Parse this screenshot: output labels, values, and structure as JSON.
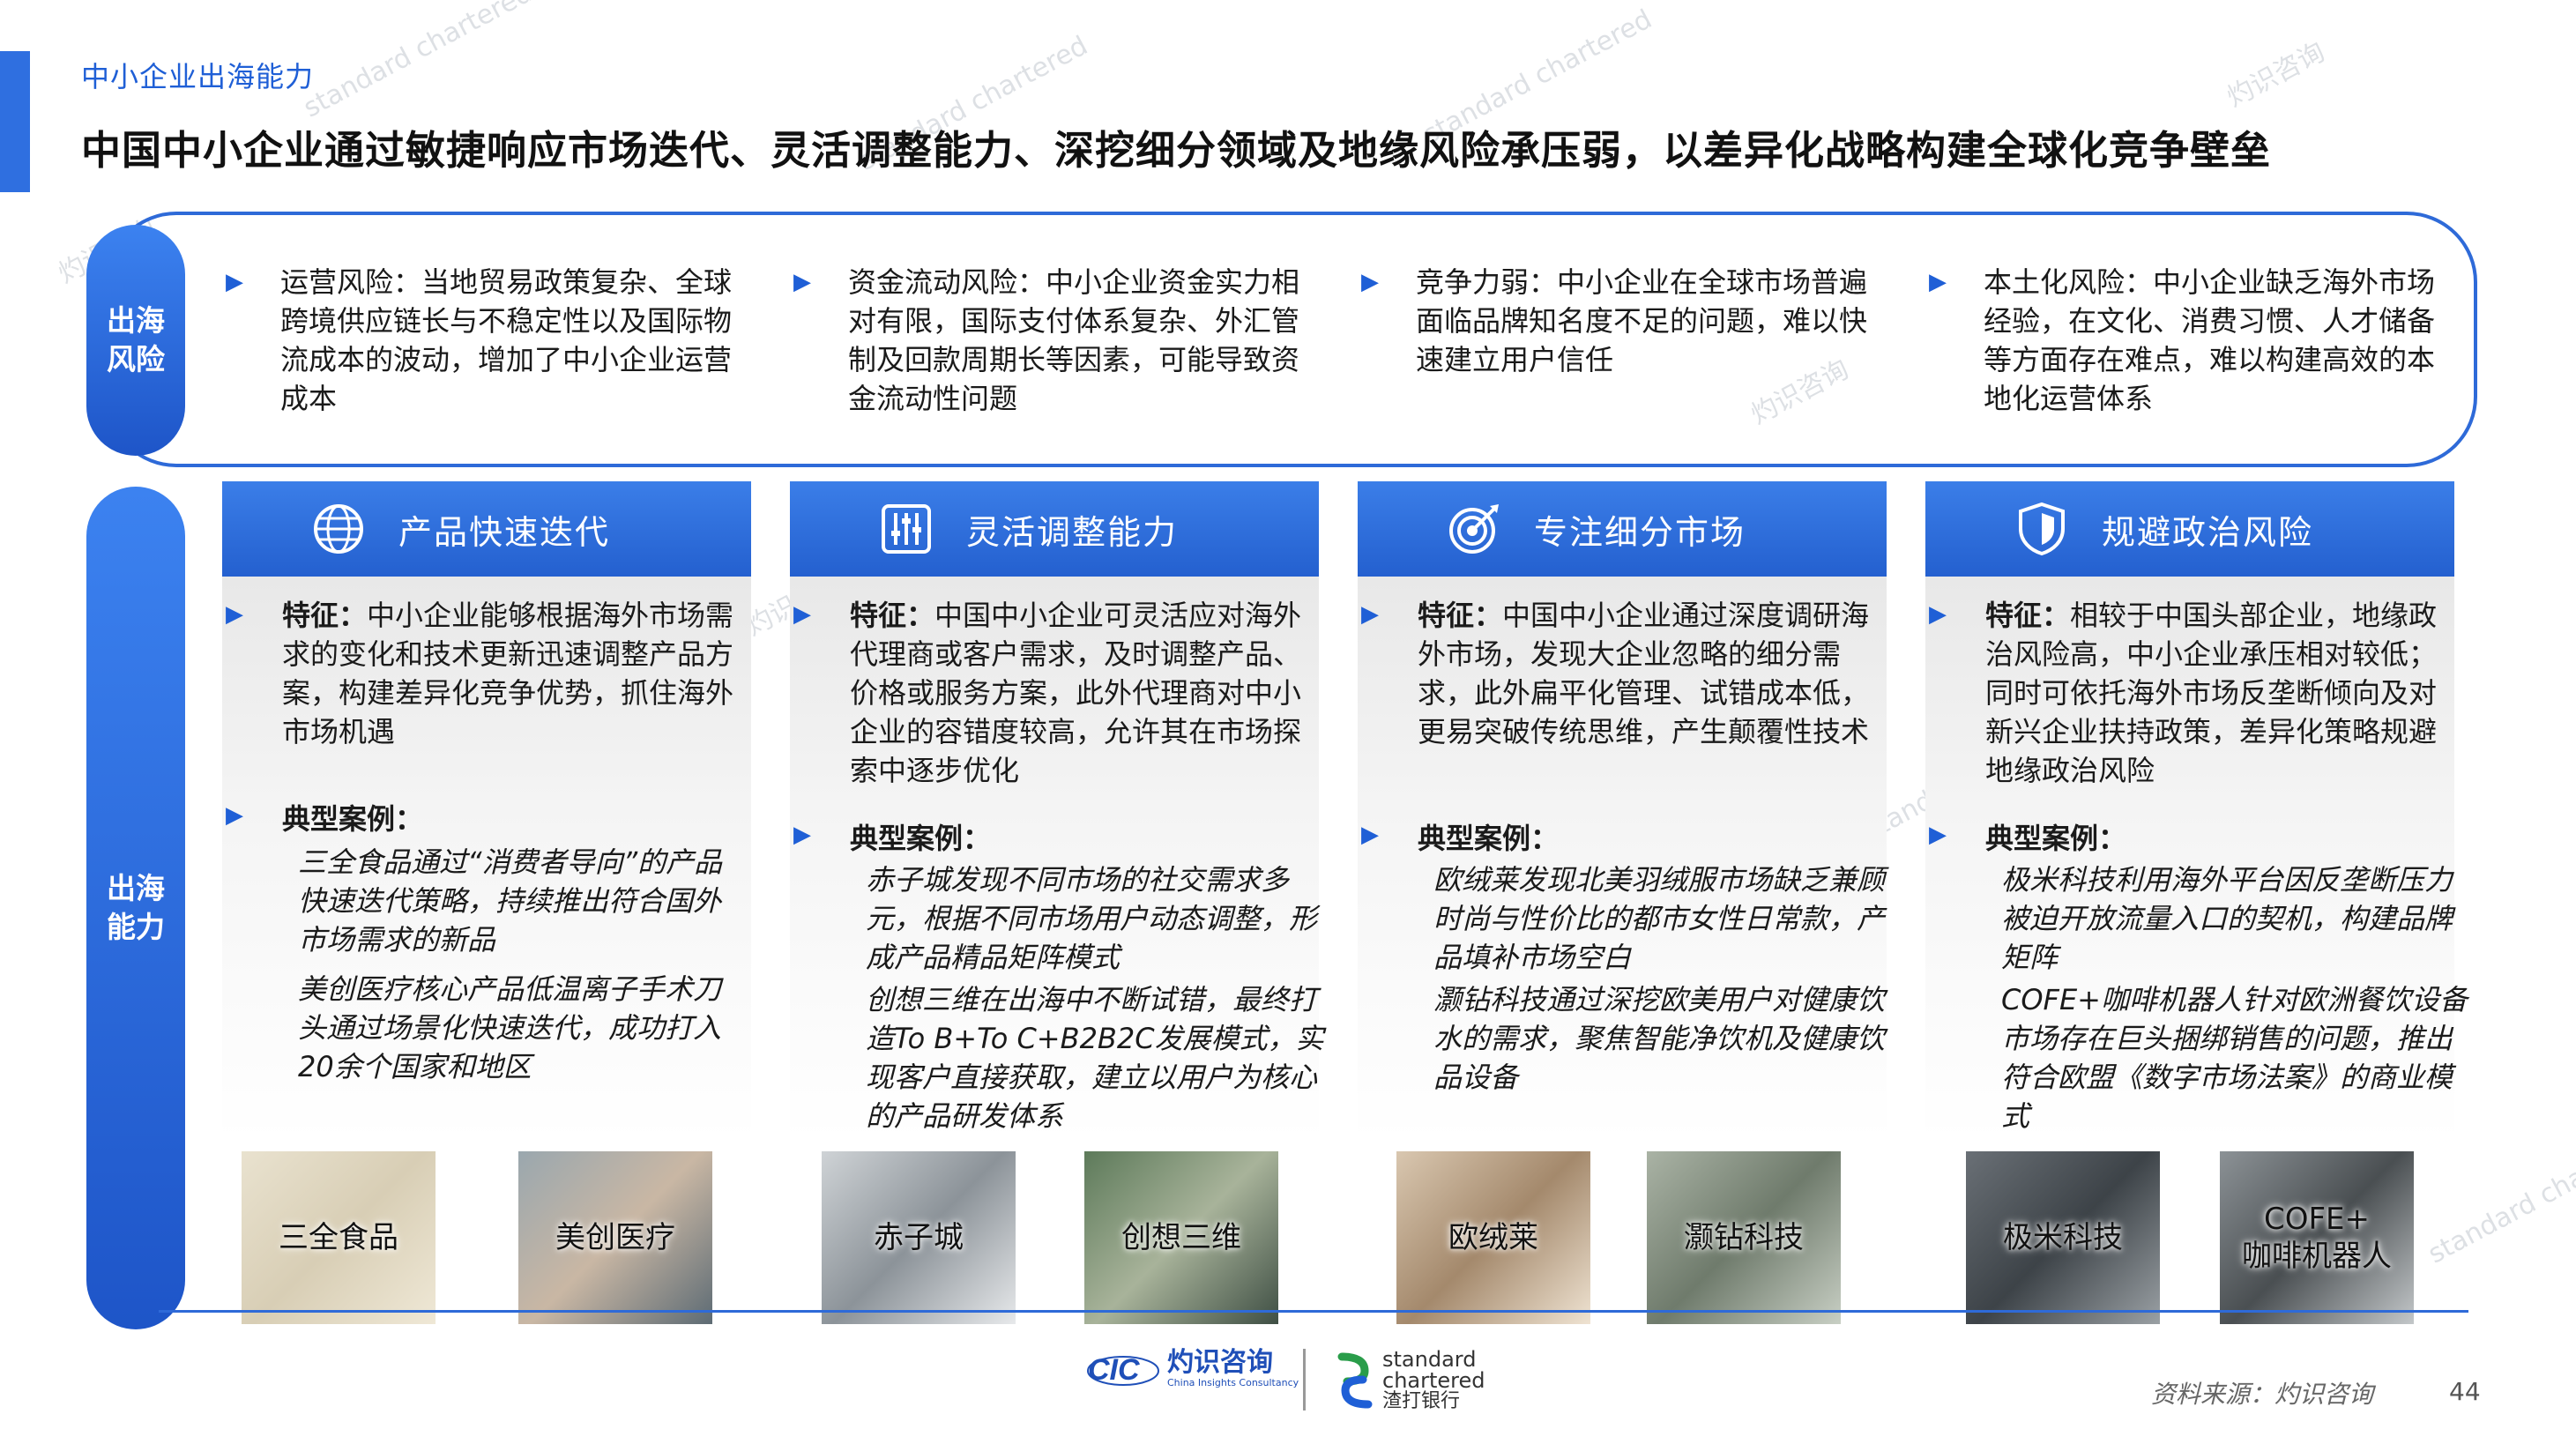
{
  "section_label": "中小企业出海能力",
  "headline": "中国中小企业通过敏捷响应市场迭代、灵活调整能力、深挖细分领域及地缘风险承压弱，以差异化战略构建全球化竞争壁垒",
  "risk_label": "出海风险",
  "ability_label": "出海能力",
  "risks": [
    {
      "text": "运营风险：当地贸易政策复杂、全球跨境供应链长与不稳定性以及国际物流成本的波动，增加了中小企业运营成本"
    },
    {
      "text": "资金流动风险：中小企业资金实力相对有限，国际支付体系复杂、外汇管制及回款周期长等因素，可能导致资金流动性问题"
    },
    {
      "text": "竞争力弱：中小企业在全球市场普遍面临品牌知名度不足的问题，难以快速建立用户信任"
    },
    {
      "text": "本土化风险：中小企业缺乏海外市场经验，在文化、消费习惯、人才储备等方面存在难点，难以构建高效的本地化运营体系"
    }
  ],
  "columns": [
    {
      "title": "产品快速迭代",
      "icon": "globe-icon",
      "feature_label": "特征：",
      "feature": "中小企业能够根据海外市场需求的变化和技术更新迅速调整产品方案，构建差异化竞争优势，抓住海外市场机遇",
      "cases_label": "典型案例：",
      "cases": [
        "三全食品通过“消费者导向”的产品快速迭代策略，持续推出符合国外市场需求的新品",
        "美创医疗核心产品低温离子手术刀头通过场景化快速迭代，成功打入20余个国家和地区"
      ],
      "images": [
        "三全食品",
        "美创医疗"
      ]
    },
    {
      "title": "灵活调整能力",
      "icon": "sliders-icon",
      "feature_label": "特征：",
      "feature": "中国中小企业可灵活应对海外代理商或客户需求，及时调整产品、价格或服务方案，此外代理商对中小企业的容错度较高，允许其在市场探索中逐步优化",
      "cases_label": "典型案例：",
      "cases": [
        "赤子城发现不同市场的社交需求多元，根据不同市场用户动态调整，形成产品精品矩阵模式",
        "创想三维在出海中不断试错，最终打造To B+To C+B2B2C发展模式，实现客户直接获取，建立以用户为核心的产品研发体系"
      ],
      "images": [
        "赤子城",
        "创想三维"
      ]
    },
    {
      "title": "专注细分市场",
      "icon": "target-icon",
      "feature_label": "特征：",
      "feature": "中国中小企业通过深度调研海外市场，发现大企业忽略的细分需求，此外扁平化管理、试错成本低，更易突破传统思维，产生颠覆性技术",
      "cases_label": "典型案例：",
      "cases": [
        "欧绒莱发现北美羽绒服市场缺乏兼顾时尚与性价比的都市女性日常款，产品填补市场空白",
        "灏钻科技通过深挖欧美用户对健康饮水的需求，聚焦智能净饮机及健康饮品设备"
      ],
      "images": [
        "欧绒莱",
        "灏钻科技"
      ]
    },
    {
      "title": "规避政治风险",
      "icon": "shield-icon",
      "feature_label": "特征：",
      "feature": "相较于中国头部企业，地缘政治风险高，中小企业承压相对较低；同时可依托海外市场反垄断倾向及对新兴企业扶持政策，差异化策略规避地缘政治风险",
      "cases_label": "典型案例：",
      "cases": [
        "极米科技利用海外平台因反垄断压力被迫开放流量入口的契机，构建品牌矩阵",
        "COFE+咖啡机器人针对欧洲餐饮设备市场存在巨头捆绑销售的问题，推出符合欧盟《数字市场法案》的商业模式"
      ],
      "images": [
        "极米科技",
        "COFE+\n咖啡机器人"
      ]
    }
  ],
  "footer": {
    "cic_cn": "灼识咨询",
    "cic_en": "China Insights Consultancy",
    "sc_en_1": "standard",
    "sc_en_2": "chartered",
    "sc_cn": "渣打银行",
    "source": "资料来源：灼识咨询",
    "page": "44"
  },
  "colors": {
    "accent": "#2e6ad8",
    "header_grad_top": "#3b7ee8",
    "header_grad_bottom": "#2460cf"
  }
}
